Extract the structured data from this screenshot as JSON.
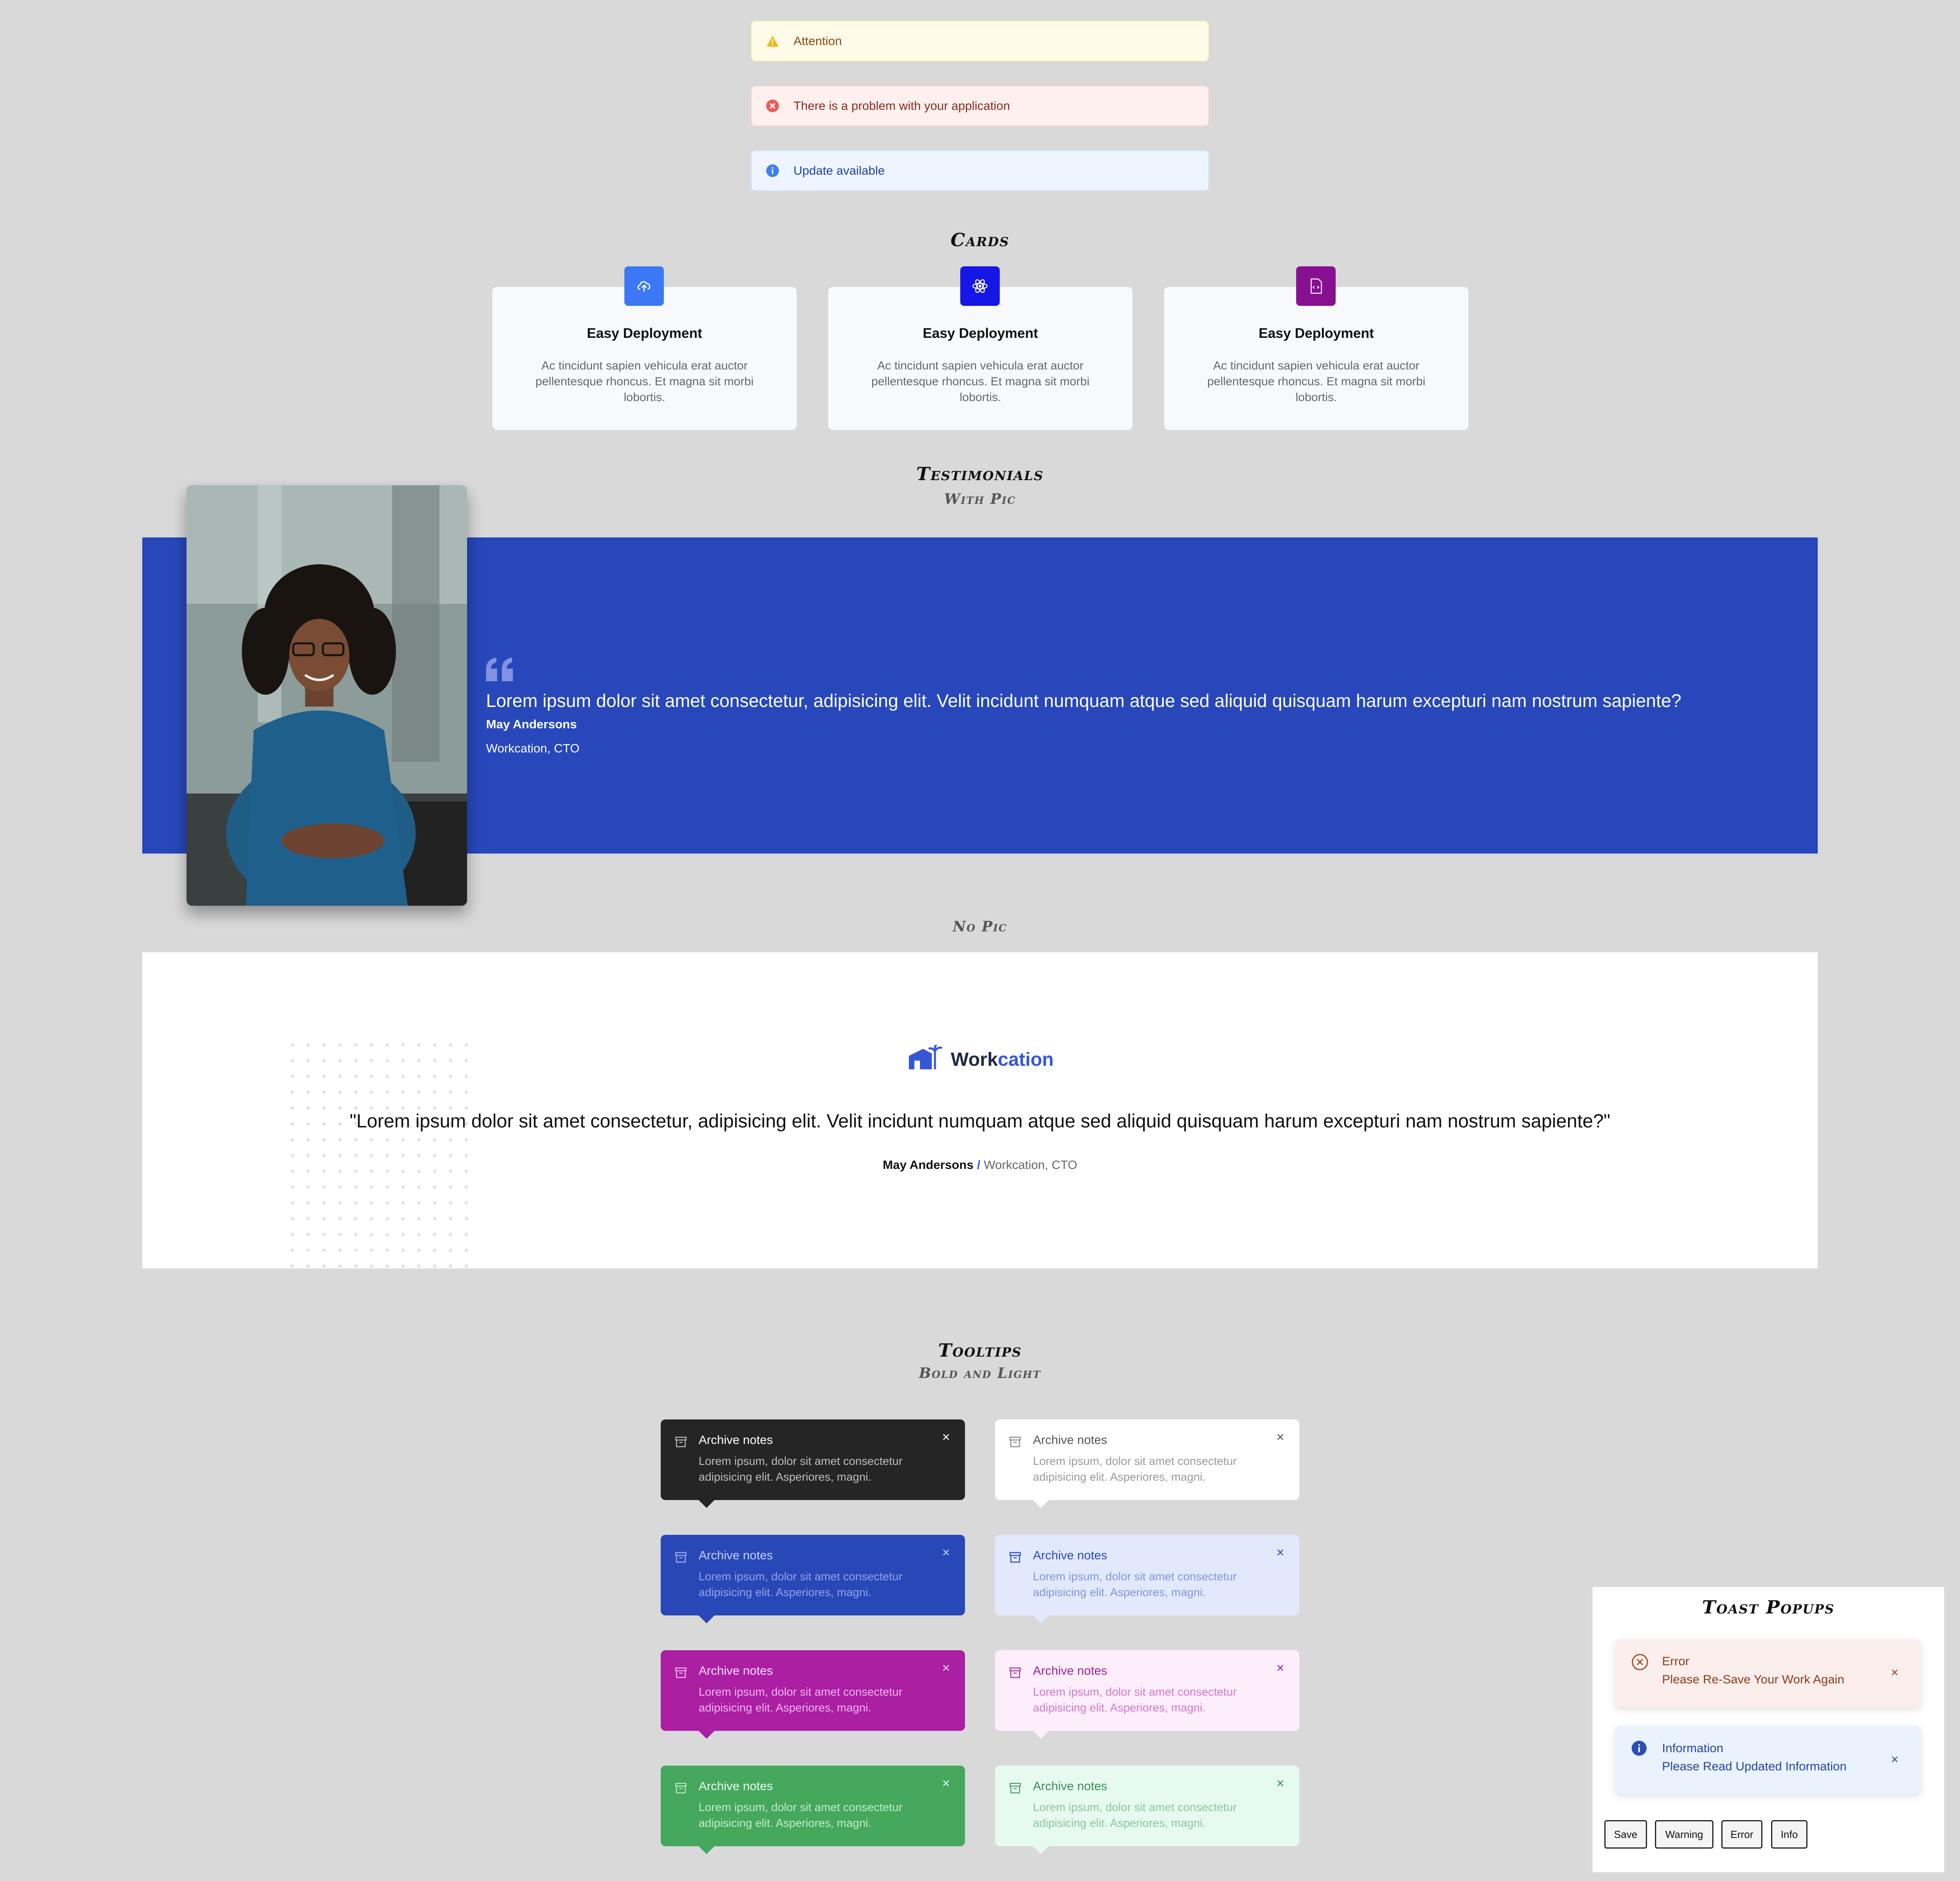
{
  "alerts": {
    "warning": "Attention",
    "error": "There is a problem with your application",
    "info": "Update available"
  },
  "colors": {
    "page_bg": "#d9d9d9",
    "testimonial_band": "#2747bb",
    "brand_blue": "#3557d6",
    "card_icon_1": "#3c78f5",
    "card_icon_2": "#1616e6",
    "card_icon_3": "#86108f"
  },
  "cards": {
    "section_title": "Cards",
    "items": [
      {
        "icon": "cloud-upload-icon",
        "title": "Easy Deployment",
        "body": "Ac tincidunt sapien vehicula erat auctor pellentesque rhoncus. Et magna sit morbi lobortis."
      },
      {
        "icon": "atom-icon",
        "title": "Easy Deployment",
        "body": "Ac tincidunt sapien vehicula erat auctor pellentesque rhoncus. Et magna sit morbi lobortis."
      },
      {
        "icon": "file-code-icon",
        "title": "Easy Deployment",
        "body": "Ac tincidunt sapien vehicula erat auctor pellentesque rhoncus. Et magna sit morbi lobortis."
      }
    ]
  },
  "testimonials": {
    "section_title": "Testimonials",
    "with_pic": {
      "subtitle": "With Pic",
      "quote": "Lorem ipsum dolor sit amet consectetur, adipisicing elit. Velit incidunt numquam atque sed aliquid quisquam harum excepturi nam nostrum sapiente?",
      "name": "May Andersons",
      "role": "Workcation, CTO"
    },
    "no_pic": {
      "subtitle": "No Pic",
      "logo_text_a": "Work",
      "logo_text_b": "cation",
      "quote": "\"Lorem ipsum dolor sit amet consectetur, adipisicing elit. Velit incidunt numquam atque sed aliquid quisquam harum excepturi nam nostrum sapiente?\"",
      "name": "May Andersons",
      "separator": "/",
      "role": "Workcation, CTO"
    }
  },
  "tooltips": {
    "section_title": "Tooltips",
    "subtitle": "Bold and Light",
    "items": [
      {
        "title": "Archive notes",
        "body": "Lorem ipsum, dolor sit amet consectetur adipisicing elit. Asperiores, magni.",
        "close": "×"
      },
      {
        "title": "Archive notes",
        "body": "Lorem ipsum, dolor sit amet consectetur adipisicing elit. Asperiores, magni.",
        "close": "×"
      },
      {
        "title": "Archive notes",
        "body": "Lorem ipsum, dolor sit amet consectetur adipisicing elit. Asperiores, magni.",
        "close": "×"
      },
      {
        "title": "Archive notes",
        "body": "Lorem ipsum, dolor sit amet consectetur adipisicing elit. Asperiores, magni.",
        "close": "×"
      },
      {
        "title": "Archive notes",
        "body": "Lorem ipsum, dolor sit amet consectetur adipisicing elit. Asperiores, magni.",
        "close": "×"
      },
      {
        "title": "Archive notes",
        "body": "Lorem ipsum, dolor sit amet consectetur adipisicing elit. Asperiores, magni.",
        "close": "×"
      },
      {
        "title": "Archive notes",
        "body": "Lorem ipsum, dolor sit amet consectetur adipisicing elit. Asperiores, magni.",
        "close": "×"
      },
      {
        "title": "Archive notes",
        "body": "Lorem ipsum, dolor sit amet consectetur adipisicing elit. Asperiores, magni.",
        "close": "×"
      }
    ]
  },
  "toasts": {
    "section_title": "Toast Popups",
    "error": {
      "title": "Error",
      "message": "Please Re-Save Your Work Again",
      "close": "×"
    },
    "info": {
      "title": "Information",
      "message": "Please Read Updated Information",
      "close": "×"
    },
    "buttons": {
      "save": "Save",
      "warning": "Warning",
      "error": "Error",
      "info": "Info"
    }
  }
}
